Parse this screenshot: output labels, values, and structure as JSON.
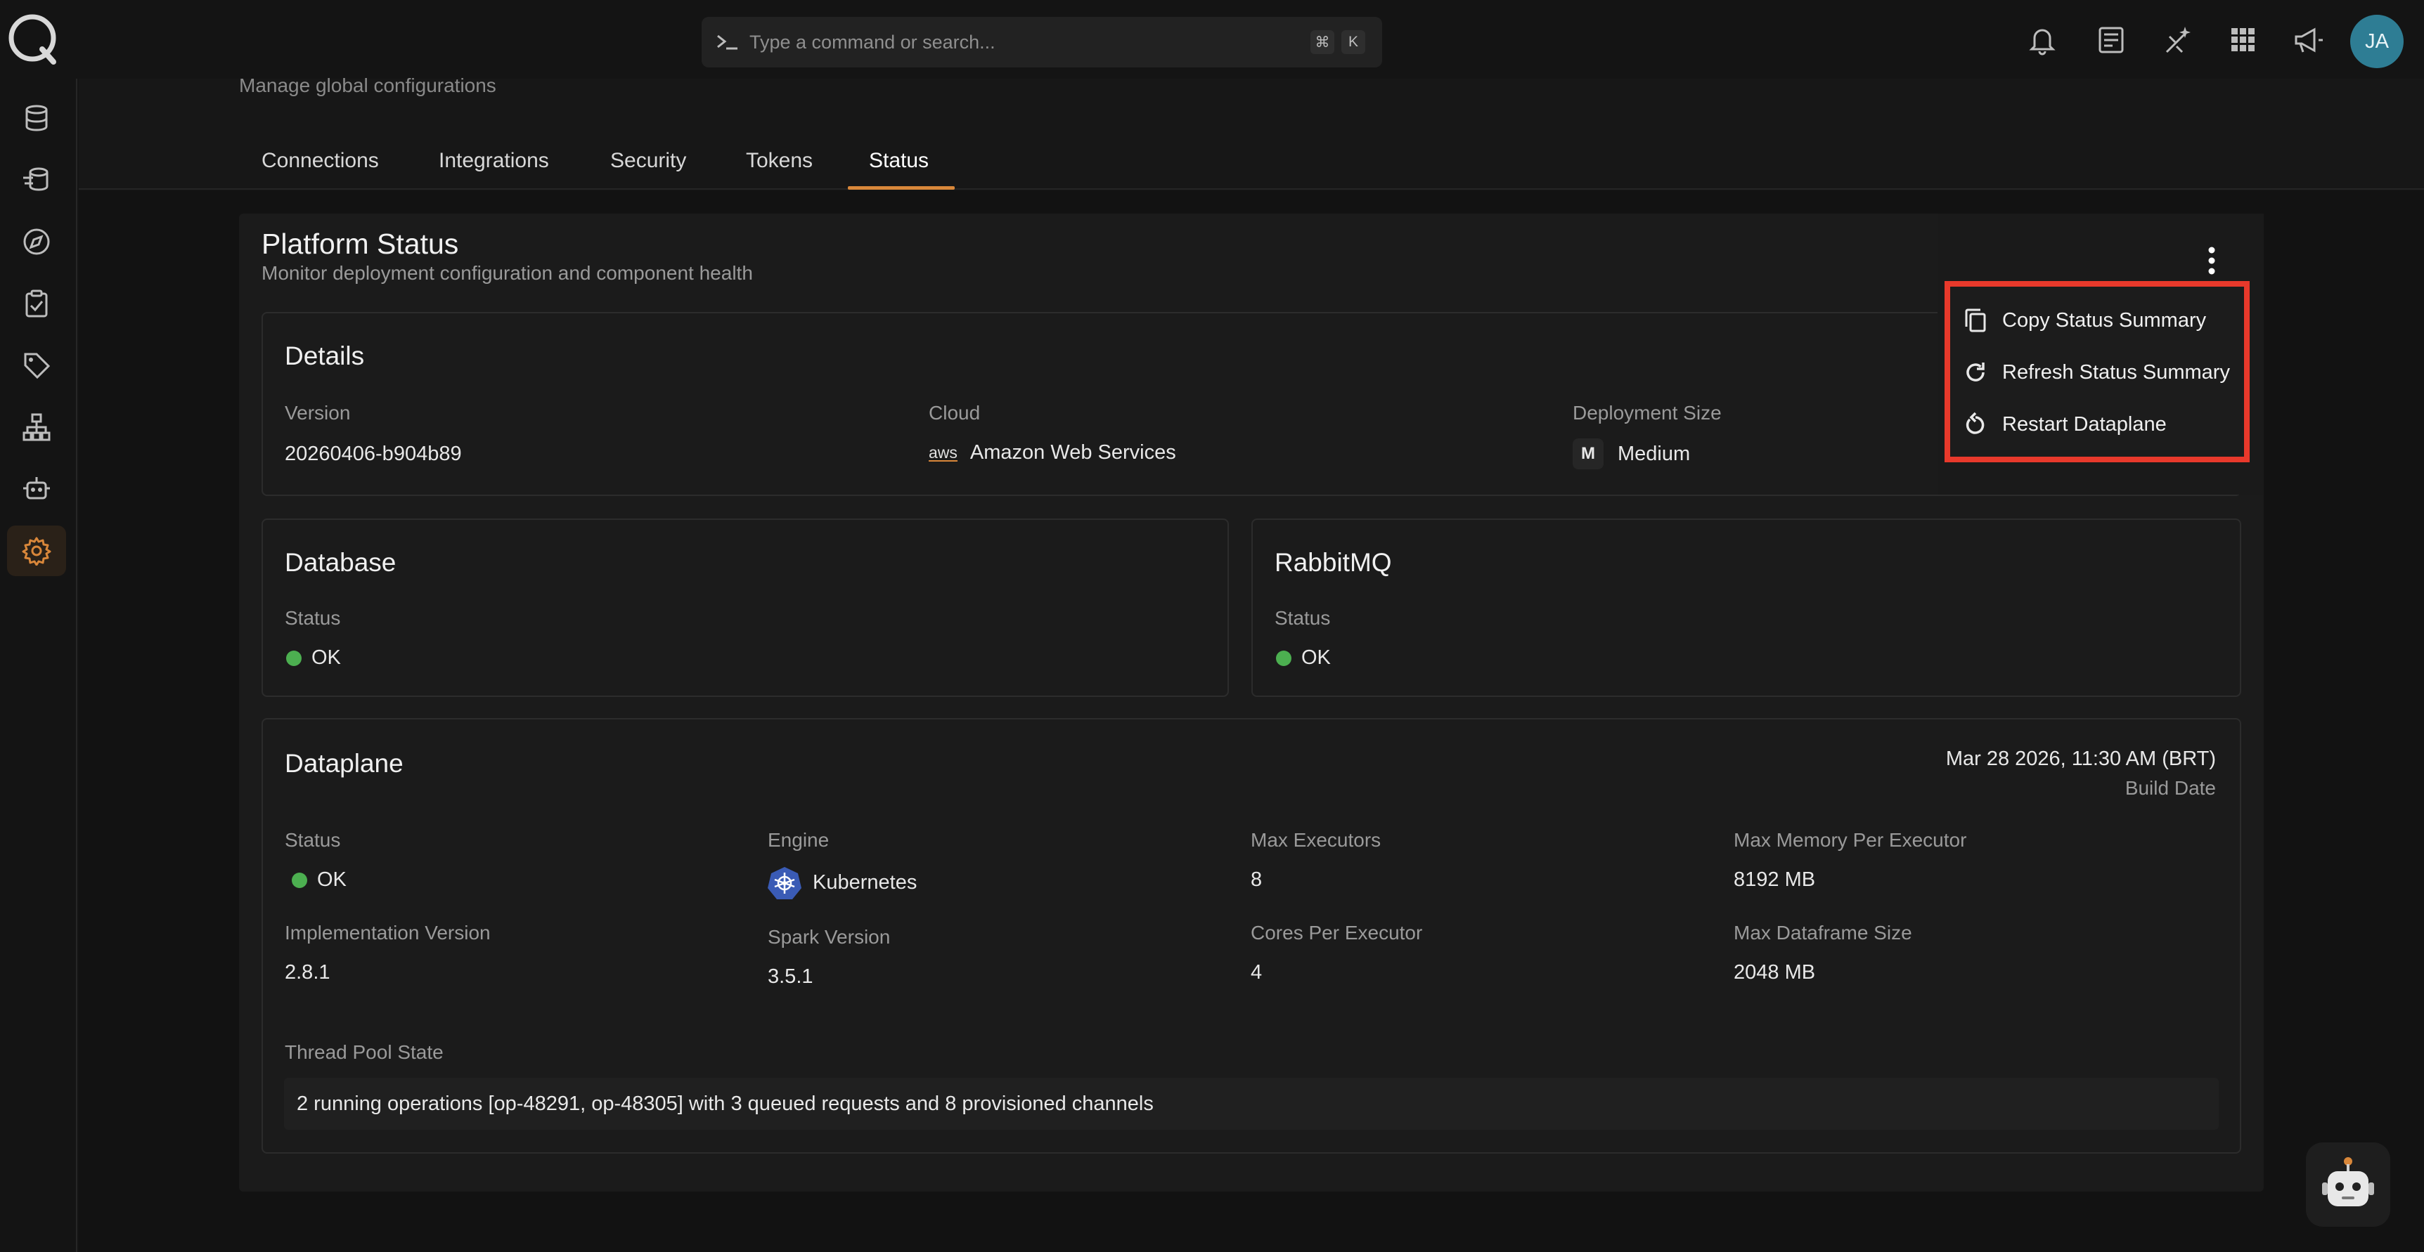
{
  "command_bar": {
    "placeholder": "Type a command or search...",
    "key1": "⌘",
    "key2": "K"
  },
  "user": {
    "initials": "JA"
  },
  "header": {
    "subtitle": "Manage global configurations",
    "tabs": [
      {
        "label": "Connections"
      },
      {
        "label": "Integrations"
      },
      {
        "label": "Security"
      },
      {
        "label": "Tokens"
      },
      {
        "label": "Status",
        "active": true
      }
    ]
  },
  "status_page": {
    "title": "Platform Status",
    "subtitle": "Monitor deployment configuration and component health",
    "details": {
      "title": "Details",
      "version_label": "Version",
      "version_value": "20260406-b904b89",
      "cloud_label": "Cloud",
      "cloud_logo": "aws",
      "cloud_value": "Amazon Web Services",
      "size_label": "Deployment Size",
      "size_badge": "M",
      "size_value": "Medium"
    },
    "database": {
      "title": "Database",
      "status_label": "Status",
      "status_value": "OK"
    },
    "rabbitmq": {
      "title": "RabbitMQ",
      "status_label": "Status",
      "status_value": "OK"
    },
    "dataplane": {
      "title": "Dataplane",
      "build_date": "Mar 28 2026, 11:30 AM (BRT)",
      "build_date_label": "Build Date",
      "status_label": "Status",
      "status_value": "OK",
      "engine_label": "Engine",
      "engine_value": "Kubernetes",
      "max_executors_label": "Max Executors",
      "max_executors_value": "8",
      "max_memory_label": "Max Memory Per Executor",
      "max_memory_value": "8192 MB",
      "impl_version_label": "Implementation Version",
      "impl_version_value": "2.8.1",
      "spark_version_label": "Spark Version",
      "spark_version_value": "3.5.1",
      "cores_label": "Cores Per Executor",
      "cores_value": "4",
      "max_df_label": "Max Dataframe Size",
      "max_df_value": "2048 MB",
      "thread_pool_label": "Thread Pool State",
      "thread_pool_value": "2 running operations [op-48291, op-48305] with 3 queued requests and 8 provisioned channels"
    }
  },
  "menu": {
    "items": [
      {
        "label": "Copy Status Summary",
        "icon": "copy-icon"
      },
      {
        "label": "Refresh Status Summary",
        "icon": "refresh-icon"
      },
      {
        "label": "Restart Dataplane",
        "icon": "restart-icon"
      }
    ]
  },
  "colors": {
    "accent": "#d9873a",
    "ok": "#4caf50",
    "highlight": "#e8392b",
    "avatar": "#2e7d94"
  }
}
